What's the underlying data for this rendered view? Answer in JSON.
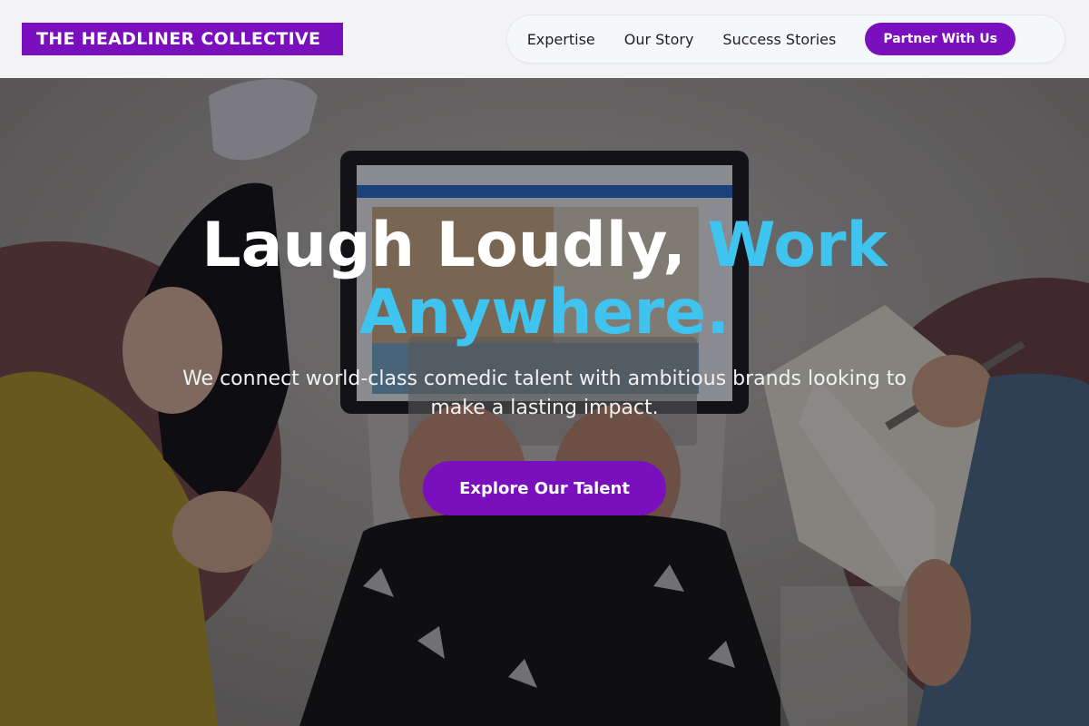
{
  "header": {
    "logo_text": "THE HEADLINER COLLECTIVE",
    "nav": [
      {
        "label": "Expertise"
      },
      {
        "label": "Our Story"
      },
      {
        "label": "Success Stories"
      }
    ],
    "cta_label": "Partner With Us"
  },
  "hero": {
    "headline_white": "Laugh Loudly, ",
    "headline_accent": "Work Anywhere.",
    "subtitle": "We connect world-class comedic talent with ambitious brands looking to make a lasting impact.",
    "button_label": "Explore Our Talent",
    "background_image": "overhead-photo-of-people-working-on-laptop-and-notebook"
  },
  "colors": {
    "brand_purple": "#7a0fbd",
    "accent_blue": "#3fc4f0",
    "header_bg": "#f3f3f6"
  }
}
